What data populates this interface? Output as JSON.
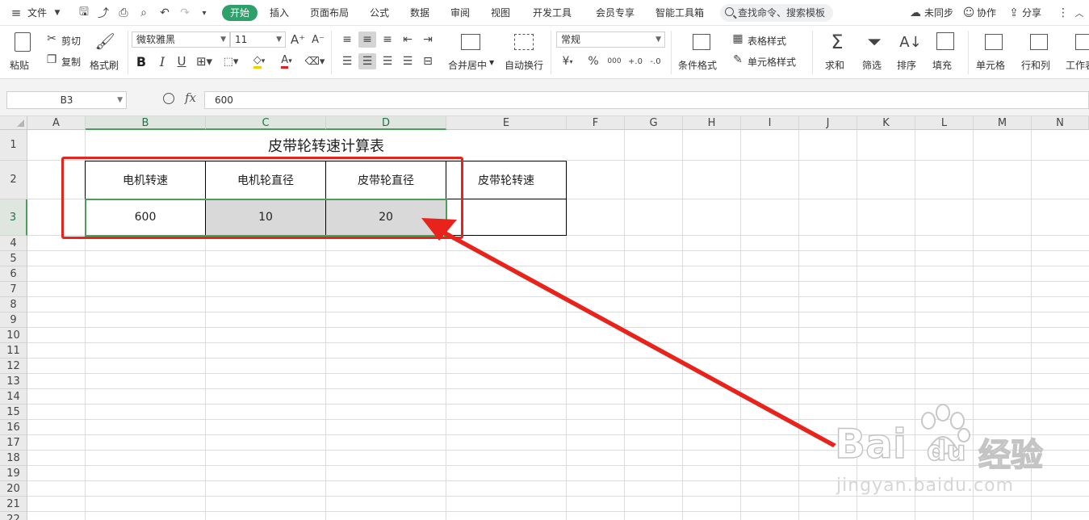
{
  "menubar": {
    "file": "文件",
    "tabs": [
      "开始",
      "插入",
      "页面布局",
      "公式",
      "数据",
      "审阅",
      "视图",
      "开发工具",
      "会员专享",
      "智能工具箱"
    ],
    "search": "查找命令、搜索模板",
    "right": [
      "未同步",
      "协作",
      "分享"
    ]
  },
  "ribbon": {
    "paste": "粘贴",
    "cut": "剪切",
    "copy": "复制",
    "format_painter": "格式刷",
    "font_name": "微软雅黑",
    "font_size": "11",
    "merge_center": "合并居中",
    "wrap_text": "自动换行",
    "number_format": "常规",
    "table_style": "表格样式",
    "cell_style": "单元格样式",
    "conditional_format": "条件格式",
    "sum": "求和",
    "filter": "筛选",
    "sort": "排序",
    "fill": "填充",
    "cell": "单元格",
    "row_col": "行和列",
    "worksheet": "工作表",
    "bold": "B",
    "italic": "I",
    "underline": "U",
    "currency": "¥",
    "percent": "%",
    "thousands": "000",
    "dec_inc": "+.0",
    "dec_dec": "-.0"
  },
  "formula_bar": {
    "name_box": "B3",
    "fx": "fx",
    "value": "600"
  },
  "columns": [
    "A",
    "B",
    "C",
    "D",
    "E",
    "F",
    "G",
    "H",
    "I",
    "J",
    "K",
    "L",
    "M",
    "N"
  ],
  "rows": [
    "1",
    "2",
    "3",
    "4",
    "5",
    "6",
    "7",
    "8",
    "9",
    "10",
    "11",
    "12",
    "13",
    "14",
    "15",
    "16",
    "17",
    "18",
    "19",
    "20",
    "21",
    "22"
  ],
  "sheet": {
    "title": "皮带轮转速计算表",
    "headers": [
      "电机转速",
      "电机轮直径",
      "皮带轮直径",
      "皮带轮转速"
    ],
    "values": [
      "600",
      "10",
      "20",
      ""
    ]
  },
  "watermark": {
    "brand_left": "Bai",
    "brand_mid": "du",
    "brand_cn": "经验",
    "url": "jingyan.baidu.com"
  },
  "colors": {
    "accent": "#2ea06b",
    "annotation": "#e8231c",
    "selection": "#4aa05b",
    "selected_fill": "#d9d9d9"
  }
}
